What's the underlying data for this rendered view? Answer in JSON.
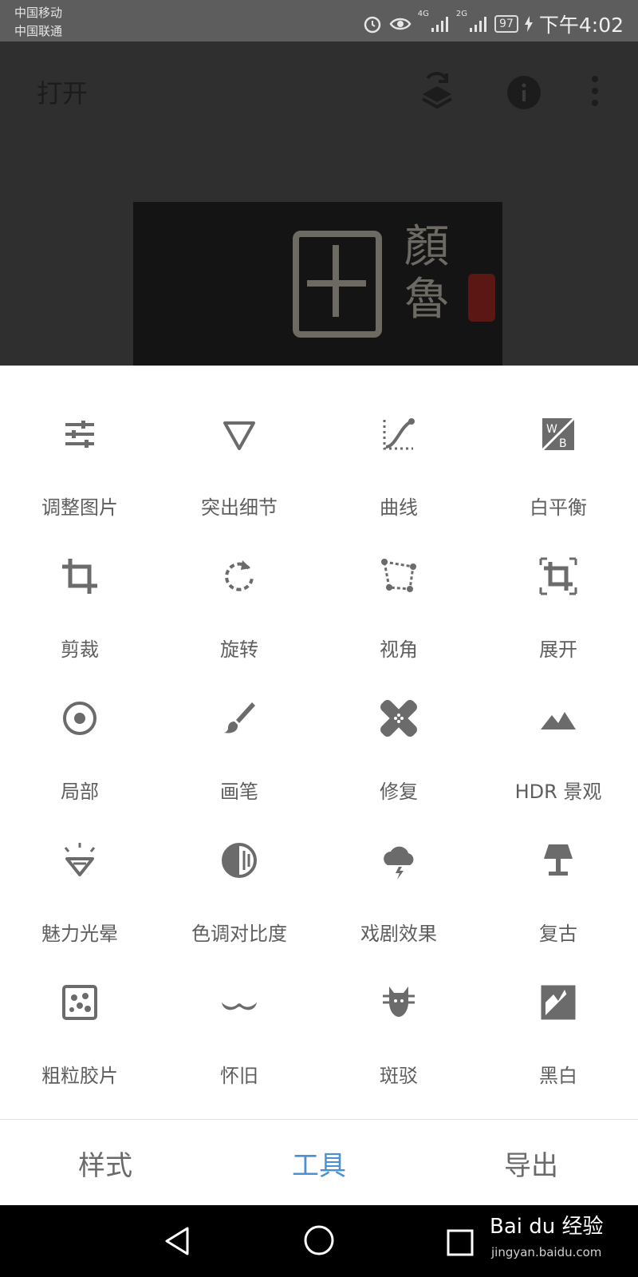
{
  "status_bar": {
    "carrier_1": "中国移动",
    "carrier_2": "中国联通",
    "net_1": "4G",
    "net_2": "2G",
    "battery": "97",
    "time": "下午4:02"
  },
  "header": {
    "title": "打开",
    "icons": [
      "layers-icon",
      "info-icon",
      "more-vert-icon"
    ]
  },
  "preview": {
    "calligraphy": "顏魯"
  },
  "tools": [
    {
      "label": "调整图片",
      "icon": "tune-icon"
    },
    {
      "label": "突出细节",
      "icon": "details-triangle-icon"
    },
    {
      "label": "曲线",
      "icon": "curves-icon"
    },
    {
      "label": "白平衡",
      "icon": "white-balance-icon"
    },
    {
      "label": "剪裁",
      "icon": "crop-icon"
    },
    {
      "label": "旋转",
      "icon": "rotate-icon"
    },
    {
      "label": "视角",
      "icon": "perspective-icon"
    },
    {
      "label": "展开",
      "icon": "expand-icon"
    },
    {
      "label": "局部",
      "icon": "selective-icon"
    },
    {
      "label": "画笔",
      "icon": "brush-icon"
    },
    {
      "label": "修复",
      "icon": "healing-icon"
    },
    {
      "label": "HDR 景观",
      "icon": "hdr-landscape-icon"
    },
    {
      "label": "魅力光晕",
      "icon": "glamour-glow-icon"
    },
    {
      "label": "色调对比度",
      "icon": "tonal-contrast-icon"
    },
    {
      "label": "戏剧效果",
      "icon": "drama-icon"
    },
    {
      "label": "复古",
      "icon": "vintage-icon"
    },
    {
      "label": "粗粒胶片",
      "icon": "grainy-film-icon"
    },
    {
      "label": "怀旧",
      "icon": "retrolux-icon"
    },
    {
      "label": "斑驳",
      "icon": "grunge-icon"
    },
    {
      "label": "黑白",
      "icon": "black-white-icon"
    }
  ],
  "tabs": {
    "styles": "样式",
    "tools": "工具",
    "export": "导出",
    "active": "工具"
  },
  "watermark": {
    "line1": "Bai du 经验",
    "line2": "jingyan.baidu.com"
  },
  "colors": {
    "accent": "#4a90d9",
    "icon": "#6b6b6b",
    "label": "#5e5e5e"
  }
}
